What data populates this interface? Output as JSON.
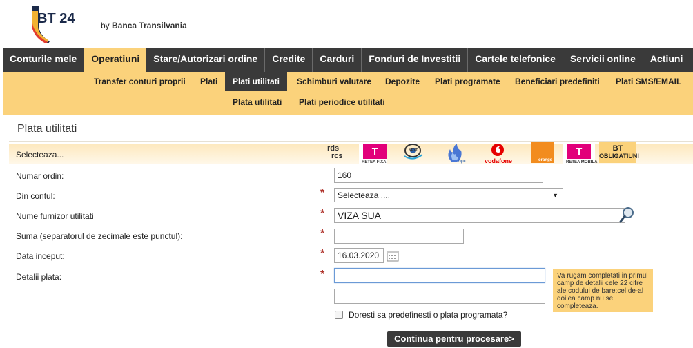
{
  "header": {
    "logo_text": "BT 24",
    "byline_prefix": "by",
    "byline_brand": "Banca Transilvania"
  },
  "mainnav": [
    {
      "label": "Conturile mele"
    },
    {
      "label": "Operatiuni"
    },
    {
      "label": "Stare/Autorizari ordine"
    },
    {
      "label": "Credite"
    },
    {
      "label": "Carduri"
    },
    {
      "label": "Fonduri de Investitii"
    },
    {
      "label": "Cartele telefonice"
    },
    {
      "label": "Servicii online"
    },
    {
      "label": "Actiuni"
    }
  ],
  "subnav": [
    {
      "label": "Transfer conturi proprii"
    },
    {
      "label": "Plati"
    },
    {
      "label": "Plati utilitati"
    },
    {
      "label": "Schimburi valutare"
    },
    {
      "label": "Depozite"
    },
    {
      "label": "Plati programate"
    },
    {
      "label": "Beneficiari predefiniti"
    },
    {
      "label": "Plati SMS/EMAIL"
    }
  ],
  "subnav2": [
    {
      "label": "Plata utilitati"
    },
    {
      "label": "Plati periodice utilitati"
    }
  ],
  "page": {
    "title": "Plata utilitati"
  },
  "logos": {
    "rds_line1": "rds",
    "rds_line2": "rcs",
    "telekom_letter": "T",
    "telekom_fixa_caption": "RETEA FIXA",
    "nextgen_caption": "NEXT",
    "upc_caption": "upc",
    "vodafone_caption": "vodafone",
    "orange_caption": "orange",
    "telekom_mobila_caption": "RETEA MOBILA",
    "bt_line1": "BT",
    "bt_line2": "OBLIGATIUNI"
  },
  "form": {
    "select_label": "Selecteaza...",
    "numar_label": "Numar ordin:",
    "numar_value": "160",
    "cont_label": "Din contul:",
    "cont_value": "Selecteaza ....",
    "furnizor_label": "Nume furnizor utilitati",
    "furnizor_value": "VIZA SUA",
    "suma_label": "Suma (separatorul de zecimale este punctul):",
    "suma_value": "",
    "data_label": "Data inceput:",
    "data_value": "16.03.2020",
    "detalii_label": "Detalii plata:",
    "detalii_value1": "",
    "detalii_value2": "",
    "required_mark": "*",
    "note": "Va rugam completati in primul camp de detalii cele 22 cifre ale codului de bare;cel de-al doilea camp nu se completeaza.",
    "checkbox_label": "Doresti sa predefinesti o plata programata?",
    "submit_label": "Continua pentru procesare>"
  },
  "colors": {
    "nav_dark": "#3a3a3a",
    "accent_yellow": "#fbd27b",
    "telekom_magenta": "#e2007a",
    "orange": "#f28c1e",
    "vodafone_red": "#e60000",
    "required_red": "#b0342c"
  }
}
